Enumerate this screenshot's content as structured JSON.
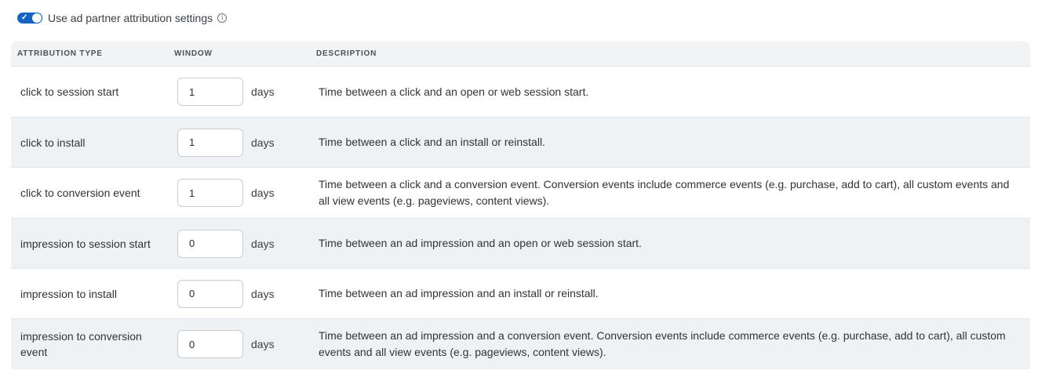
{
  "toggle": {
    "label": "Use ad partner attribution settings",
    "enabled": true,
    "check_glyph": "✓",
    "info_glyph": "i"
  },
  "table": {
    "headers": {
      "type": "ATTRIBUTION TYPE",
      "window": "WINDOW",
      "description": "DESCRIPTION"
    },
    "unit_label": "days",
    "rows": [
      {
        "type": "click to session start",
        "value": "1",
        "description": "Time between a click and an open or web session start."
      },
      {
        "type": "click to install",
        "value": "1",
        "description": "Time between a click and an install or reinstall."
      },
      {
        "type": "click to conversion event",
        "value": "1",
        "description": "Time between a click and a conversion event. Conversion events include commerce events (e.g. purchase, add to cart), all custom events and all view events (e.g. pageviews, content views)."
      },
      {
        "type": "impression to session start",
        "value": "0",
        "description": "Time between an ad impression and an open or web session start."
      },
      {
        "type": "impression to install",
        "value": "0",
        "description": "Time between an ad impression and an install or reinstall."
      },
      {
        "type": "impression to conversion event",
        "value": "0",
        "description": "Time between an ad impression and a conversion event. Conversion events include commerce events (e.g. purchase, add to cart), all custom events and all view events (e.g. pageviews, content views)."
      }
    ]
  },
  "colors": {
    "accent": "#1565c0",
    "header_bg": "#f1f3f5",
    "alt_row_bg": "#eff2f5"
  }
}
